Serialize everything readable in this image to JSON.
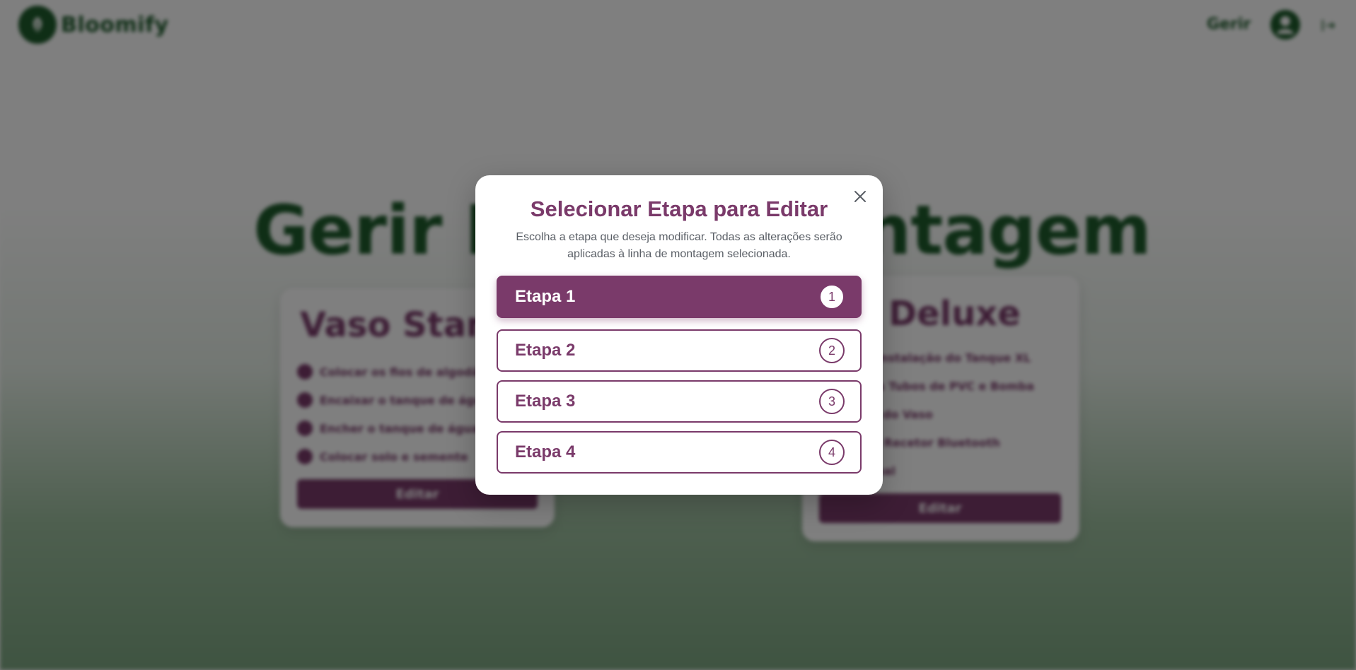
{
  "header": {
    "brand": "Bloomify",
    "nav_label": "Gerir"
  },
  "page": {
    "title_part_a": "Gerir L",
    "title_part_b": "ntagem",
    "cards": [
      {
        "title": "Vaso Stand",
        "steps": [
          "Colocar os fios de algodão",
          "Encaixar o tanque de água",
          "Encher o tanque de água",
          "Colocar solo e semente"
        ],
        "button_label": "Editar"
      },
      {
        "title": "so Deluxe",
        "steps": [
          "ação e Instalação do Tanque XL",
          "gem dos Tubos de PVC e Bomba",
          "amento do Vaso",
          "ação do Recetor Bluetooth",
          "ação Final"
        ],
        "button_label": "Editar"
      }
    ]
  },
  "modal": {
    "title": "Selecionar Etapa para Editar",
    "description": "Escolha a etapa que deseja modificar. Todas as alterações serão aplicadas à linha de montagem selecionada.",
    "close_icon": "close-icon",
    "selected_index": 0,
    "options": [
      {
        "label": "Etapa 1",
        "number": "1"
      },
      {
        "label": "Etapa 2",
        "number": "2"
      },
      {
        "label": "Etapa 3",
        "number": "3"
      },
      {
        "label": "Etapa 4",
        "number": "4"
      }
    ]
  },
  "colors": {
    "brand_green": "#1e5c2c",
    "accent_plum": "#7a3a6a",
    "overlay": "rgba(0,0,0,0.5)"
  }
}
